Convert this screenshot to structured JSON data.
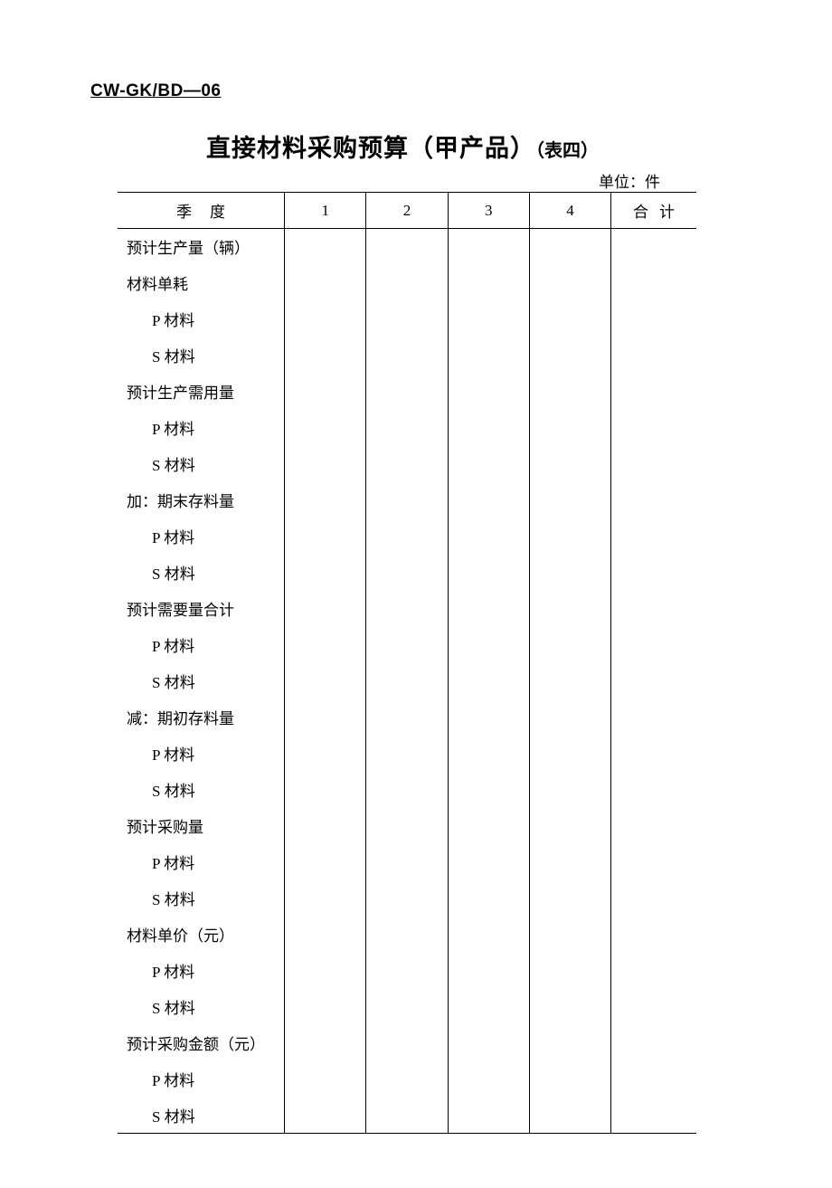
{
  "doc_code": "CW-GK/BD—06",
  "title_main": "直接材料采购预算（甲产品）",
  "title_sub": "（表四）",
  "unit_label": "单位：件",
  "headers": {
    "quarter": "季度",
    "col1": "1",
    "col2": "2",
    "col3": "3",
    "col4": "4",
    "total": "合计"
  },
  "rows": [
    {
      "label": "预计生产量（辆）",
      "indent": false,
      "v1": "",
      "v2": "",
      "v3": "",
      "v4": "",
      "vt": ""
    },
    {
      "label": "材料单耗",
      "indent": false,
      "v1": "",
      "v2": "",
      "v3": "",
      "v4": "",
      "vt": ""
    },
    {
      "label": "P 材料",
      "indent": true,
      "v1": "",
      "v2": "",
      "v3": "",
      "v4": "",
      "vt": ""
    },
    {
      "label": "S 材料",
      "indent": true,
      "v1": "",
      "v2": "",
      "v3": "",
      "v4": "",
      "vt": ""
    },
    {
      "label": "预计生产需用量",
      "indent": false,
      "v1": "",
      "v2": "",
      "v3": "",
      "v4": "",
      "vt": ""
    },
    {
      "label": "P 材料",
      "indent": true,
      "v1": "",
      "v2": "",
      "v3": "",
      "v4": "",
      "vt": ""
    },
    {
      "label": "S 材料",
      "indent": true,
      "v1": "",
      "v2": "",
      "v3": "",
      "v4": "",
      "vt": ""
    },
    {
      "label": "加：期末存料量",
      "indent": false,
      "v1": "",
      "v2": "",
      "v3": "",
      "v4": "",
      "vt": ""
    },
    {
      "label": "P 材料",
      "indent": true,
      "v1": "",
      "v2": "",
      "v3": "",
      "v4": "",
      "vt": ""
    },
    {
      "label": "S 材料",
      "indent": true,
      "v1": "",
      "v2": "",
      "v3": "",
      "v4": "",
      "vt": ""
    },
    {
      "label": "预计需要量合计",
      "indent": false,
      "v1": "",
      "v2": "",
      "v3": "",
      "v4": "",
      "vt": ""
    },
    {
      "label": "P 材料",
      "indent": true,
      "v1": "",
      "v2": "",
      "v3": "",
      "v4": "",
      "vt": ""
    },
    {
      "label": "S 材料",
      "indent": true,
      "v1": "",
      "v2": "",
      "v3": "",
      "v4": "",
      "vt": ""
    },
    {
      "label": "减：期初存料量",
      "indent": false,
      "v1": "",
      "v2": "",
      "v3": "",
      "v4": "",
      "vt": ""
    },
    {
      "label": "P 材料",
      "indent": true,
      "v1": "",
      "v2": "",
      "v3": "",
      "v4": "",
      "vt": ""
    },
    {
      "label": "S 材料",
      "indent": true,
      "v1": "",
      "v2": "",
      "v3": "",
      "v4": "",
      "vt": ""
    },
    {
      "label": "预计采购量",
      "indent": false,
      "v1": "",
      "v2": "",
      "v3": "",
      "v4": "",
      "vt": ""
    },
    {
      "label": "P 材料",
      "indent": true,
      "v1": "",
      "v2": "",
      "v3": "",
      "v4": "",
      "vt": ""
    },
    {
      "label": "S 材料",
      "indent": true,
      "v1": "",
      "v2": "",
      "v3": "",
      "v4": "",
      "vt": ""
    },
    {
      "label": "材料单价（元）",
      "indent": false,
      "v1": "",
      "v2": "",
      "v3": "",
      "v4": "",
      "vt": ""
    },
    {
      "label": "P 材料",
      "indent": true,
      "v1": "",
      "v2": "",
      "v3": "",
      "v4": "",
      "vt": ""
    },
    {
      "label": "S 材料",
      "indent": true,
      "v1": "",
      "v2": "",
      "v3": "",
      "v4": "",
      "vt": ""
    },
    {
      "label": "预计采购金额（元）",
      "indent": false,
      "v1": "",
      "v2": "",
      "v3": "",
      "v4": "",
      "vt": ""
    },
    {
      "label": "P 材料",
      "indent": true,
      "v1": "",
      "v2": "",
      "v3": "",
      "v4": "",
      "vt": ""
    },
    {
      "label": "S 材料",
      "indent": true,
      "v1": "",
      "v2": "",
      "v3": "",
      "v4": "",
      "vt": ""
    }
  ]
}
